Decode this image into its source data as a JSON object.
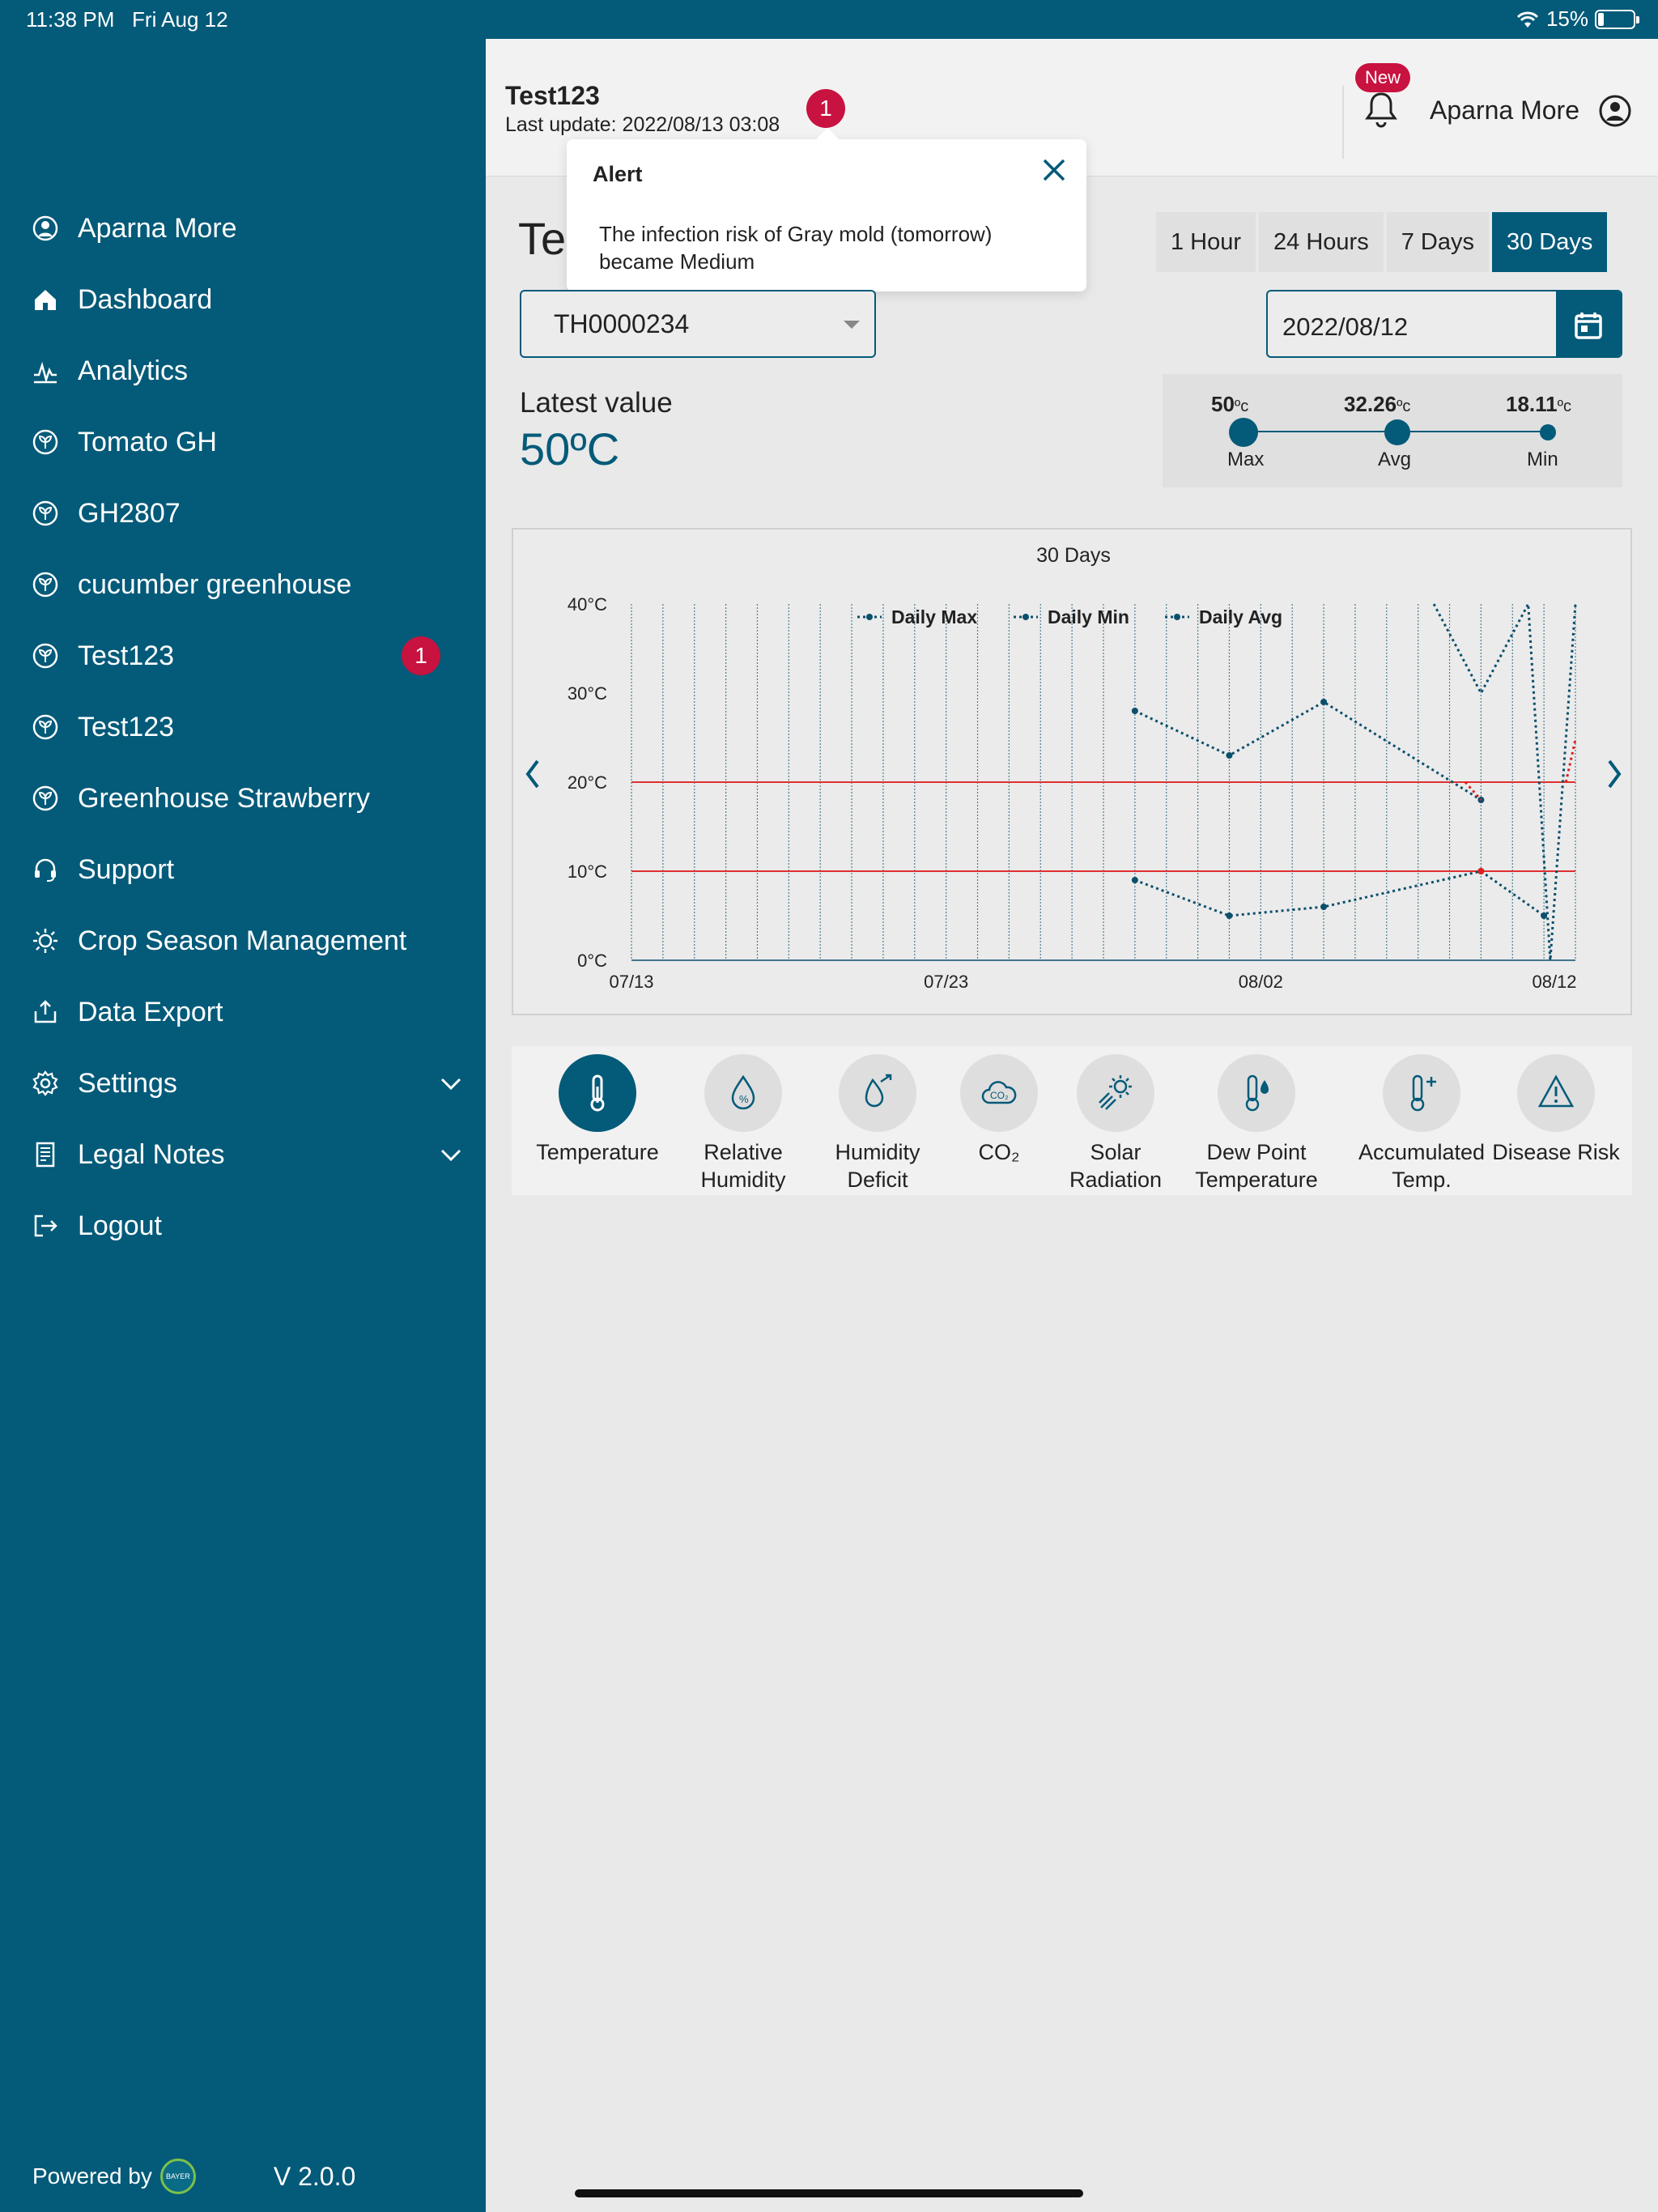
{
  "status_bar": {
    "time": "11:38 PM",
    "date": "Fri Aug 12",
    "battery": "15%",
    "battery_level": 0.15
  },
  "sidebar": {
    "items": [
      {
        "label": "Aparna More",
        "icon": "user-icon"
      },
      {
        "label": "Dashboard",
        "icon": "home-icon"
      },
      {
        "label": "Analytics",
        "icon": "analytics-icon"
      },
      {
        "label": "Tomato GH",
        "icon": "leaf-icon"
      },
      {
        "label": "GH2807",
        "icon": "leaf-icon"
      },
      {
        "label": "cucumber greenhouse",
        "icon": "leaf-icon"
      },
      {
        "label": "Test123",
        "icon": "leaf-icon",
        "badge": "1"
      },
      {
        "label": "Test123",
        "icon": "leaf-icon"
      },
      {
        "label": "Greenhouse Strawberry",
        "icon": "leaf-icon"
      },
      {
        "label": "Support",
        "icon": "headset-icon"
      },
      {
        "label": "Crop Season Management",
        "icon": "sun-icon"
      },
      {
        "label": "Data Export",
        "icon": "export-icon"
      },
      {
        "label": "Settings",
        "icon": "gear-icon"
      },
      {
        "label": "Legal Notes",
        "icon": "document-icon"
      },
      {
        "label": "Logout",
        "icon": "logout-icon"
      }
    ],
    "powered_by": "Powered by",
    "version": "V 2.0.0"
  },
  "header": {
    "title": "Test123",
    "last_update": "Last update: 2022/08/13 03:08",
    "alert_count": "1",
    "new_badge": "New",
    "user_name": "Aparna More"
  },
  "alert_popup": {
    "title": "Alert",
    "message": "The infection risk of Gray mold (tomorrow) became Medium"
  },
  "page": {
    "title_visible": "Te",
    "ranges": [
      "1 Hour",
      "24 Hours",
      "7 Days",
      "30 Days"
    ],
    "active_range": "30 Days",
    "device": "TH0000234",
    "date": "2022/08/12",
    "latest_label": "Latest value",
    "latest_value": "50",
    "latest_unit": "ºC",
    "stats": {
      "max": {
        "value": "50",
        "unit": "ºc",
        "label": "Max"
      },
      "avg": {
        "value": "32.26",
        "unit": "ºc",
        "label": "Avg"
      },
      "min": {
        "value": "18.11",
        "unit": "ºc",
        "label": "Min"
      }
    }
  },
  "chart_data": {
    "type": "line",
    "title": "30 Days",
    "x_ticks": [
      "07/13",
      "07/23",
      "08/02",
      "08/12"
    ],
    "y_ticks": [
      "0°C",
      "10°C",
      "20°C",
      "30°C",
      "40°C"
    ],
    "ylim": [
      0,
      40
    ],
    "xlim_days": [
      0,
      30
    ],
    "thresholds": [
      10,
      20
    ],
    "legend_position": "top",
    "series": [
      {
        "name": "Daily Max",
        "points": [],
        "color": "#0b4f6c"
      },
      {
        "name": "Daily Min",
        "points": [
          [
            16,
            9
          ],
          [
            19,
            5
          ],
          [
            22,
            6
          ],
          [
            27,
            10
          ],
          [
            29,
            5
          ]
        ],
        "color": "#0b4f6c"
      },
      {
        "name": "Daily Avg",
        "points": [
          [
            16,
            28
          ],
          [
            19,
            23
          ],
          [
            22,
            29
          ],
          [
            27,
            18
          ]
        ],
        "color": "#0b4f6c"
      }
    ],
    "spikes": [
      [
        25.5,
        40
      ],
      [
        27,
        30
      ],
      [
        28.5,
        40
      ],
      [
        29.2,
        0
      ],
      [
        30,
        40
      ]
    ],
    "colors": {
      "threshold": "#e03030",
      "alert_segment": "#e02020"
    }
  },
  "metrics": [
    {
      "label": "Temperature",
      "icon": "thermometer-icon",
      "active": true
    },
    {
      "label": "Relative Humidity",
      "icon": "humidity-drop-icon"
    },
    {
      "label": "Humidity Deficit",
      "icon": "humidity-deficit-icon"
    },
    {
      "label": "CO₂",
      "icon": "co2-cloud-icon"
    },
    {
      "label": "Solar Radiation",
      "icon": "solar-icon"
    },
    {
      "label": "Dew Point Temperature",
      "icon": "dew-point-icon"
    },
    {
      "label": "Accumulated Temp.",
      "icon": "accumulated-temp-icon"
    },
    {
      "label": "Disease Risk",
      "icon": "warning-icon"
    }
  ]
}
